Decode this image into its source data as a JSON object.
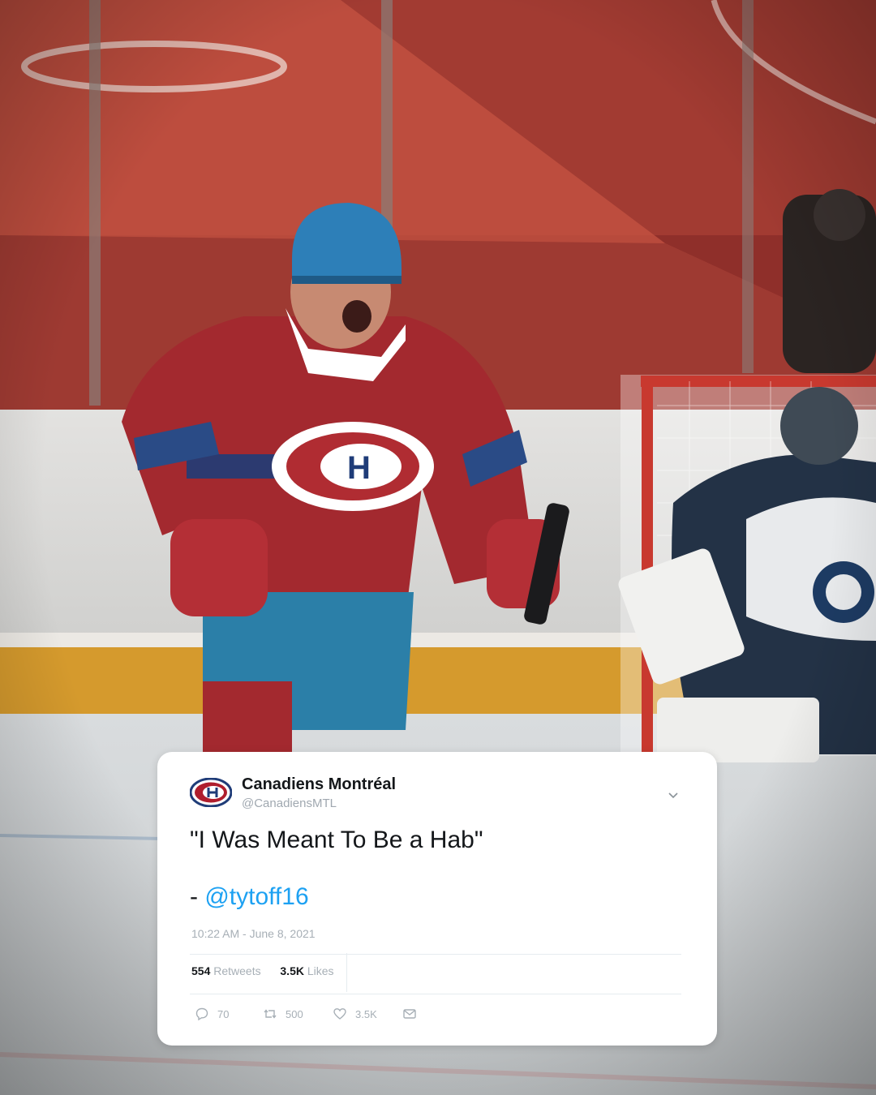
{
  "tweet": {
    "display_name": "Canadiens Montréal",
    "handle": "@CanadiensMTL",
    "text_line1": "\"I Was Meant To Be a Hab\"",
    "text_prefix": "- ",
    "mention": "@tytoff16",
    "timestamp": "10:22 AM - June 8, 2021",
    "retweets_count": "554",
    "retweets_label": "Retweets",
    "likes_count": "3.5K",
    "likes_label": "Likes",
    "actions": {
      "reply_count": "70",
      "retweet_count": "500",
      "like_count": "3.5K"
    }
  },
  "icons": {
    "team_logo": "canadiens-logo-icon",
    "menu": "chevron-down-icon",
    "reply": "reply-icon",
    "retweet": "retweet-icon",
    "like": "heart-icon",
    "share": "mail-icon"
  },
  "colors": {
    "mention": "#1da1f2",
    "jersey_red": "#a52a2f",
    "helmet_blue": "#2d7fb8"
  }
}
